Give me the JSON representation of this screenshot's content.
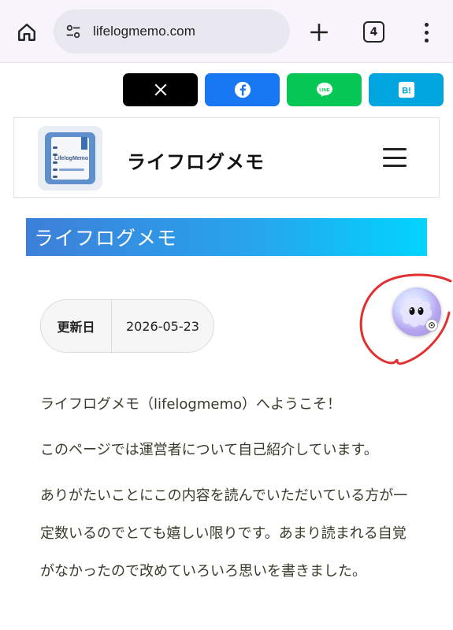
{
  "browser": {
    "url": "lifelogmemo.com",
    "tab_count": "4",
    "icons": [
      "home-icon",
      "site-settings-icon",
      "new-tab-icon",
      "tab-switcher-icon",
      "overflow-menu-icon"
    ]
  },
  "share": {
    "buttons": [
      {
        "service": "X",
        "icon": "x-logo-icon",
        "color": "#000000"
      },
      {
        "service": "Facebook",
        "icon": "facebook-icon",
        "color": "#1877f2"
      },
      {
        "service": "LINE",
        "icon": "line-icon",
        "color": "#06c755",
        "label": "LINE"
      },
      {
        "service": "Hatena Bookmark",
        "icon": "hatena-bookmark-icon",
        "color": "#00a4de",
        "label": "B!"
      }
    ]
  },
  "header": {
    "logo_text": "LifelogMemo",
    "site_title": "ライフログメモ"
  },
  "page": {
    "title": "ライフログメモ",
    "updated_label": "更新日",
    "updated_date": "2026-05-23"
  },
  "content": {
    "paragraphs": [
      "ライフログメモ（lifelogmemo）へようこそ！",
      "このページでは運営者について自己紹介しています。",
      "ありがたいことにこの内容を読んでいただいている方が一定数いるのでとても嬉しい限りです。あまり読まれる自覚がなかったので改めていろいろ思いを書きました。"
    ]
  },
  "colors": {
    "banner_start": "#3d7fd9",
    "banner_end": "#00d4ff",
    "annotation_circle": "#e03030"
  }
}
